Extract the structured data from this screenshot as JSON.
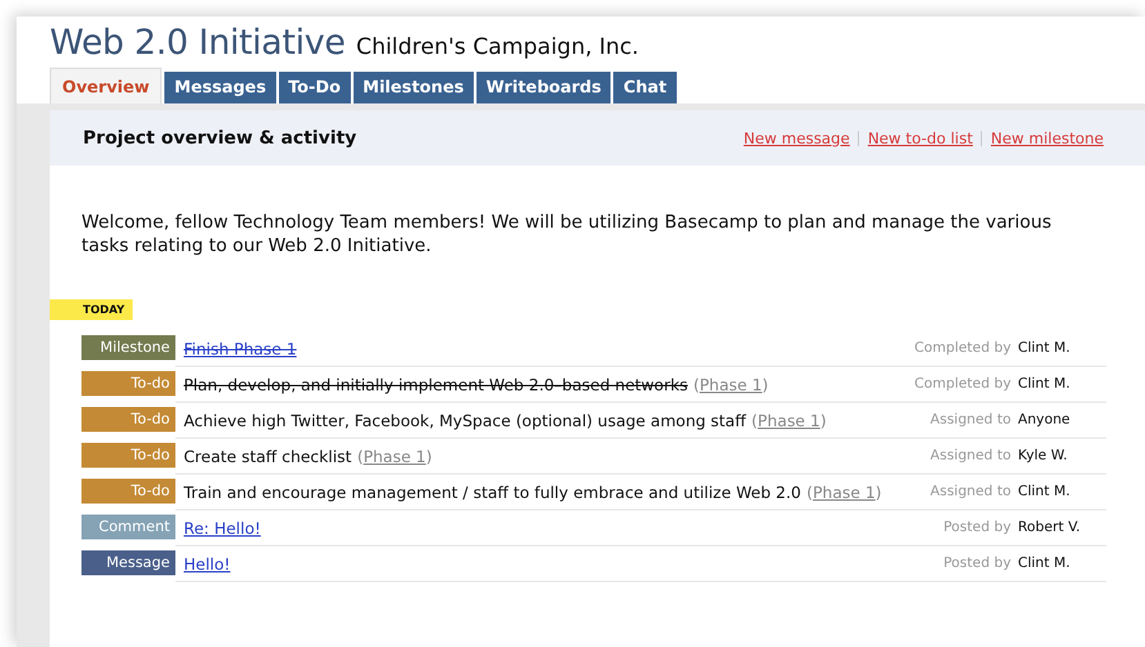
{
  "project": {
    "title": "Web 2.0 Initiative",
    "company": "Children's Campaign, Inc."
  },
  "tabs": [
    {
      "label": "Overview",
      "selected": true
    },
    {
      "label": "Messages",
      "selected": false
    },
    {
      "label": "To-Do",
      "selected": false
    },
    {
      "label": "Milestones",
      "selected": false
    },
    {
      "label": "Writeboards",
      "selected": false
    },
    {
      "label": "Chat",
      "selected": false
    }
  ],
  "panel": {
    "heading": "Project overview & activity",
    "actions": [
      "New message",
      "New to-do list",
      "New milestone"
    ]
  },
  "welcome": "Welcome, fellow Technology Team members! We will be utilizing Basecamp to plan and manage the various tasks relating to our Web 2.0 Initiative.",
  "day_label": "TODAY",
  "activity": [
    {
      "kind": "milestone",
      "badge": "Milestone",
      "title": "Finish Phase 1",
      "link": true,
      "completed": true,
      "action": "Completed by",
      "person": "Clint M."
    },
    {
      "kind": "todo",
      "badge": "To-do",
      "title": "Plan, develop, and initially implement Web 2.0–based networks",
      "link": false,
      "completed": true,
      "phase": {
        "open": "(",
        "label": "Phase 1",
        "close": ")"
      },
      "action": "Completed by",
      "person": "Clint M."
    },
    {
      "kind": "todo",
      "badge": "To-do",
      "title": "Achieve high Twitter, Facebook, MySpace (optional) usage among staff",
      "link": false,
      "completed": false,
      "phase": {
        "open": "(",
        "label": "Phase 1",
        "close": ")"
      },
      "action": "Assigned to",
      "person": "Anyone"
    },
    {
      "kind": "todo",
      "badge": "To-do",
      "title": "Create staff checklist",
      "link": false,
      "completed": false,
      "phase": {
        "open": "(",
        "label": "Phase 1",
        "close": ")"
      },
      "action": "Assigned to",
      "person": "Kyle W."
    },
    {
      "kind": "todo",
      "badge": "To-do",
      "title": "Train and encourage management / staff to fully embrace and utilize Web 2.0",
      "link": false,
      "completed": false,
      "phase": {
        "open": "(",
        "label": "Phase 1",
        "close": ")"
      },
      "action": "Assigned to",
      "person": "Clint M."
    },
    {
      "kind": "comment",
      "badge": "Comment",
      "title": "Re: Hello!",
      "link": true,
      "completed": false,
      "action": "Posted by",
      "person": "Robert V."
    },
    {
      "kind": "message",
      "badge": "Message",
      "title": "Hello!",
      "link": true,
      "completed": false,
      "action": "Posted by",
      "person": "Clint M."
    }
  ]
}
